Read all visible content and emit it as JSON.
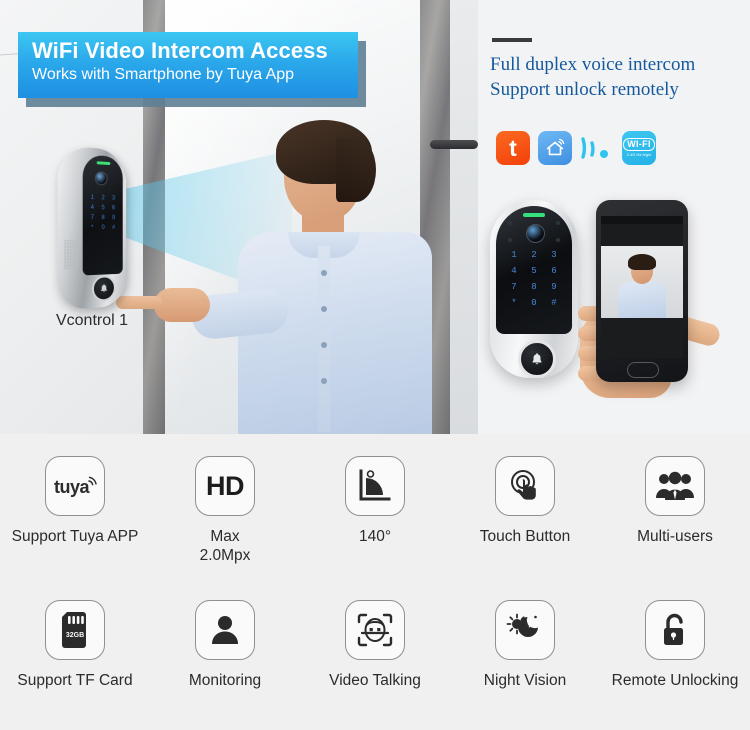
{
  "hero": {
    "banner": {
      "line1": "WiFi Video Intercom Access",
      "line2": "Works with Smartphone by Tuya App"
    },
    "device_label": "Vcontrol 1",
    "keypad": [
      "1",
      "2",
      "3",
      "4",
      "5",
      "6",
      "7",
      "8",
      "9",
      "*",
      "0",
      "#"
    ],
    "right_heading": {
      "line1": "Full duplex voice intercom",
      "line2": "Support unlock remotely"
    },
    "badges": [
      {
        "name": "tuya-badge",
        "text": "t"
      },
      {
        "name": "smart-home-badge",
        "text": ""
      },
      {
        "name": "wifi-signal-badge",
        "text": ""
      },
      {
        "name": "wifi-24g-badge",
        "text": "WI-FI",
        "sub": "2.4G Hz b/g/n"
      }
    ],
    "colors": {
      "banner_start": "#3cc7f2",
      "banner_end": "#1f8fe2",
      "banner_shadow": "#5f7f95",
      "heading_blue": "#15599c",
      "tuya_orange": "#f2400a",
      "led_green": "#35e07c",
      "key_blue": "#4b86d8"
    }
  },
  "features": {
    "background": "#f0f0f0",
    "row1": [
      {
        "icon": "tuya-icon",
        "label": "Support Tuya APP",
        "icon_text": "tuya"
      },
      {
        "icon": "hd-icon",
        "label": "Max\n2.0Mpx",
        "icon_text": "HD"
      },
      {
        "icon": "view-angle-icon",
        "label": "140°",
        "icon_text": ""
      },
      {
        "icon": "touch-button-icon",
        "label": "Touch Button",
        "icon_text": ""
      },
      {
        "icon": "multi-users-icon",
        "label": "Multi-users",
        "icon_text": ""
      }
    ],
    "row2": [
      {
        "icon": "tf-card-icon",
        "label": "Support TF Card",
        "icon_text": "32GB"
      },
      {
        "icon": "monitoring-icon",
        "label": "Monitoring",
        "icon_text": ""
      },
      {
        "icon": "video-talking-icon",
        "label": "Video Talking",
        "icon_text": ""
      },
      {
        "icon": "night-vision-icon",
        "label": "Night Vision",
        "icon_text": ""
      },
      {
        "icon": "remote-unlocking-icon",
        "label": "Remote Unlocking",
        "icon_text": ""
      }
    ]
  }
}
